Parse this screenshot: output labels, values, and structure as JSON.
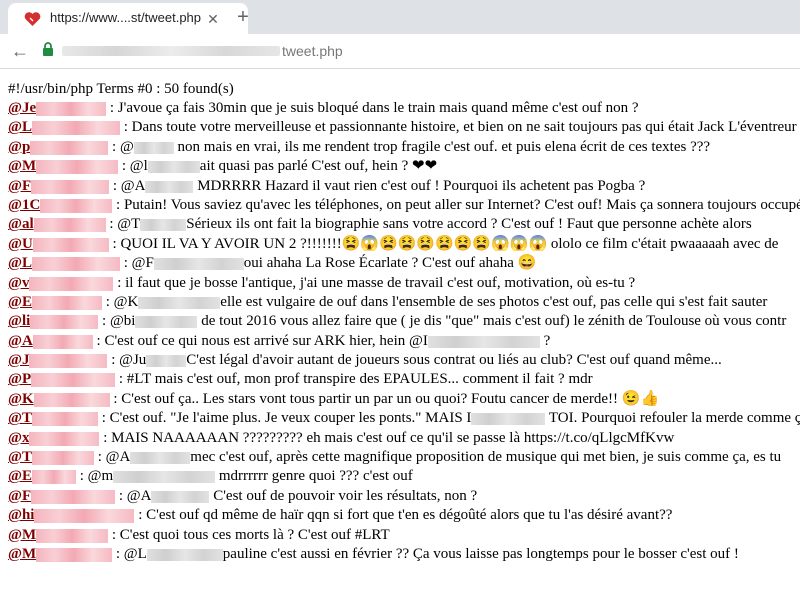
{
  "browser": {
    "tab_title": "https://www....st/tweet.php",
    "tab_close": "✕",
    "new_tab": "+",
    "back": "←",
    "url_path": "tweet.php"
  },
  "page": {
    "header": "#!/usr/bin/php Terms #0 : 50 found(s)",
    "tweets": [
      {
        "handle": "@Je",
        "pre": " : ",
        "text": "J'avoue ça fais 30min que je suis bloqué dans le train mais quand même c'est ouf non ?"
      },
      {
        "handle": "@L",
        "pre": " : ",
        "text": "Dans toute votre merveilleuse et passionnante histoire, et bien on ne sait toujours pas qui était Jack L'éventreur"
      },
      {
        "handle": "@p",
        "pre": " : ",
        "mention": "@",
        "text": " non mais en vrai, ils me rendent trop fragile c'est ouf. et puis elena écrit de ces textes ???"
      },
      {
        "handle": "@M",
        "pre": " : ",
        "mention": "@l",
        "text": "ait quasi pas parlé C'est ouf, hein ? ❤❤"
      },
      {
        "handle": "@F",
        "pre": " : ",
        "mention": "@A",
        "text": " MDRRRR Hazard il vaut rien c'est ouf ! Pourquoi ils achetent pas Pogba ?"
      },
      {
        "handle": "@1C",
        "pre": " : ",
        "text": "Putain! Vous saviez qu'avec les téléphones, on peut aller sur Internet? C'est ouf! Mais ça sonnera toujours occupé"
      },
      {
        "handle": "@al",
        "pre": " : ",
        "mention": "@T",
        "text": "Sérieux ils ont fait la biographie sans votre accord ? C'est ouf ! Faut que personne achète alors"
      },
      {
        "handle": "@U",
        "pre": " : ",
        "text": "QUOI IL VA Y AVOIR UN 2 ?!!!!!!!😫😱😫😫😫😫😫😫😱😱😱 ololo ce film c'était pwaaaaah avec de"
      },
      {
        "handle": "@L",
        "pre": " : ",
        "mention": "@F",
        "text": "oui ahaha La Rose Écarlate ? C'est ouf ahaha 😄"
      },
      {
        "handle": "@v",
        "pre": " : ",
        "text": "il faut que je bosse l'antique, j'ai une masse de travail c'est ouf, motivation, où es-tu ?"
      },
      {
        "handle": "@E",
        "pre": " : ",
        "mention": "@K",
        "text": "elle est vulgaire de ouf dans l'ensemble de ses photos c'est ouf, pas celle qui s'est fait sauter"
      },
      {
        "handle": "@li",
        "pre": " : ",
        "mention": "@bi",
        "text": " de tout 2016 vous allez faire que ( je dis \"que\" mais c'est ouf) le zénith de Toulouse où vous contr"
      },
      {
        "handle": "@A",
        "pre": " : ",
        "text": "C'est ouf ce qui nous est arrivé sur ARK hier, hein @I",
        "tail": " ?"
      },
      {
        "handle": "@J",
        "pre": " : ",
        "mention": "@Ju",
        "text": "C'est légal d'avoir autant de joueurs sous contrat ou liés au club? C'est ouf quand même..."
      },
      {
        "handle": "@P",
        "pre": " : ",
        "text": "#LT mais c'est ouf, mon prof transpire des EPAULES... comment il fait ? mdr"
      },
      {
        "handle": "@K",
        "pre": " : ",
        "text": "C'est ouf ça.. Les stars vont tous partir un par un ou quoi? Foutu cancer de merde!! 😉👍"
      },
      {
        "handle": "@T",
        "pre": " : ",
        "text": "C'est ouf. \"Je l'aime plus. Je veux couper les ponts.\" MAIS I",
        "tail": " TOI. Pourquoi refouler la merde comme ça"
      },
      {
        "handle": "@x",
        "pre": " : ",
        "text": "MAIS NAAAAAAN ????????? eh mais c'est ouf ce qu'il se passe là https://t.co/qLlgcMfKvw"
      },
      {
        "handle": "@T",
        "pre": " : ",
        "mention": "@A",
        "text": "mec c'est ouf, après cette magnifique proposition de musique qui met bien, je suis comme ça, es tu"
      },
      {
        "handle": "@E",
        "pre": " : ",
        "mention": "@m",
        "text": " mdrrrrrr genre quoi ??? c'est ouf"
      },
      {
        "handle": "@F",
        "pre": " : ",
        "mention": "@A",
        "text": " C'est ouf de pouvoir voir les résultats, non ?"
      },
      {
        "handle": "@hi",
        "pre": " : ",
        "text": "C'est ouf qd même de haïr qqn si fort que t'en es dégoûté alors que tu l'as désiré avant??"
      },
      {
        "handle": "@M",
        "pre": " : ",
        "text": "C'est quoi tous ces morts là ? C'est ouf #LRT"
      },
      {
        "handle": "@M",
        "pre": " : ",
        "mention": "@L",
        "text": "pauline c'est aussi en février ?? Ça vous laisse pas longtemps pour le bosser c'est ouf !"
      }
    ]
  }
}
